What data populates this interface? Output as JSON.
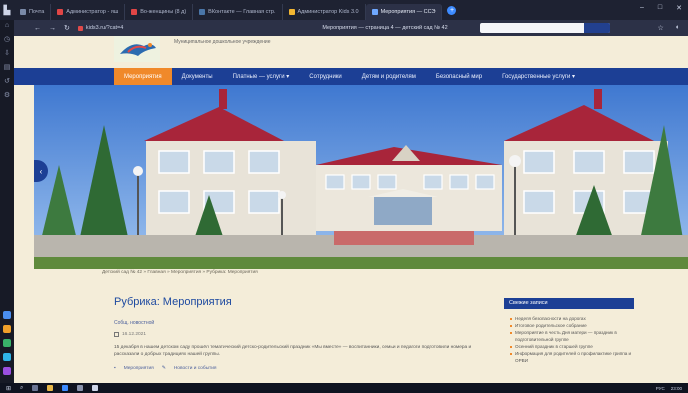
{
  "browser": {
    "tabs": [
      {
        "label": "Почта",
        "color": "#7a8aa8"
      },
      {
        "label": "Администратор - яш",
        "color": "#e14646"
      },
      {
        "label": "Во-женщины (8 д)",
        "color": "#e14646"
      },
      {
        "label": "ВКонтакте — Главная стр.",
        "color": "#4a76a8"
      },
      {
        "label": "Администратор Kids 3.0",
        "color": "#f2b632"
      },
      {
        "label": "Мероприятия — ССЭ",
        "color": "#6fa8ff"
      }
    ],
    "newtab_label": "+",
    "url": "kids3.ru/?cat=4",
    "page_title": "Мероприятия — страница 4 — детский сад № 42",
    "window_controls": [
      "–",
      "□",
      "✕"
    ]
  },
  "site": {
    "name": "Муниципальное дошкольное учреждение",
    "menu": [
      {
        "label": "Мероприятия",
        "active": true
      },
      {
        "label": "Документы",
        "active": false
      },
      {
        "label": "Платные — услуги ▾",
        "active": false
      },
      {
        "label": "Сотрудники",
        "active": false
      },
      {
        "label": "Детям и родителям",
        "active": false
      },
      {
        "label": "Безопасный мир",
        "active": false
      },
      {
        "label": "Государственные услуги ▾",
        "active": false
      }
    ],
    "slider_arrow": "‹"
  },
  "breadcrumb": "Детский сад № 42 » Главная » Мероприятия » Рубрика: Мероприятия",
  "content": {
    "title": "Рубрика: Мероприятия",
    "author": "Собщ. новостной",
    "date": "16.12.2021",
    "excerpt": "15 декабря в нашем детском саду прошёл тематический детско-родительский праздник «Мы вместе» — воспитанники, семьи и педагоги подготовили номера и рассказали о добрых традициях нашей группы.",
    "tags": [
      "Мероприятия",
      "Новости и события"
    ]
  },
  "sidebar": {
    "title": "Свежие записи",
    "items": [
      "Неделя безопасности на дорогах",
      "Итоговое родительское собрание",
      "Мероприятие в честь Дня матери — праздник в подготовительной группе",
      "Осенний праздник в старшей группе",
      "Информация для родителей о профилактике гриппа и ОРВИ"
    ]
  },
  "taskbar": {
    "clock": "23:00",
    "tray": "РУС"
  }
}
